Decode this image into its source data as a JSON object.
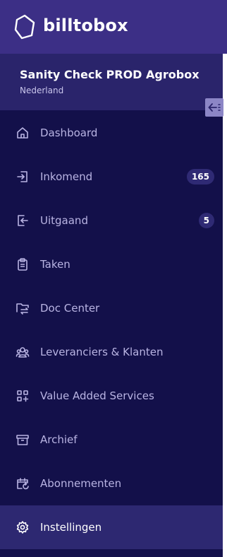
{
  "brand": {
    "name": "billtobox"
  },
  "organization": {
    "name": "Sanity Check PROD Agrobox",
    "country": "Nederland"
  },
  "nav": {
    "items": [
      {
        "label": "Dashboard",
        "icon": "home-icon"
      },
      {
        "label": "Inkomend",
        "icon": "inbox-in-icon",
        "badge": "165"
      },
      {
        "label": "Uitgaand",
        "icon": "outbox-out-icon",
        "badge": "5"
      },
      {
        "label": "Taken",
        "icon": "clipboard-icon"
      },
      {
        "label": "Doc Center",
        "icon": "folder-transfer-icon"
      },
      {
        "label": "Leveranciers & Klanten",
        "icon": "users-icon"
      },
      {
        "label": "Value Added Services",
        "icon": "apps-add-icon"
      },
      {
        "label": "Archief",
        "icon": "archive-box-icon"
      },
      {
        "label": "Abonnementen",
        "icon": "calendar-repeat-icon"
      },
      {
        "label": "Instellingen",
        "icon": "gear-icon",
        "active": true
      }
    ]
  },
  "colors": {
    "sidebar_bg": "#13104a",
    "brand_bar_bg": "#3c2f86",
    "org_block_bg": "#2a246b",
    "active_item_bg": "#2d2871",
    "nav_label": "#b9b4e3",
    "badge_bg": "#2f2a74"
  }
}
